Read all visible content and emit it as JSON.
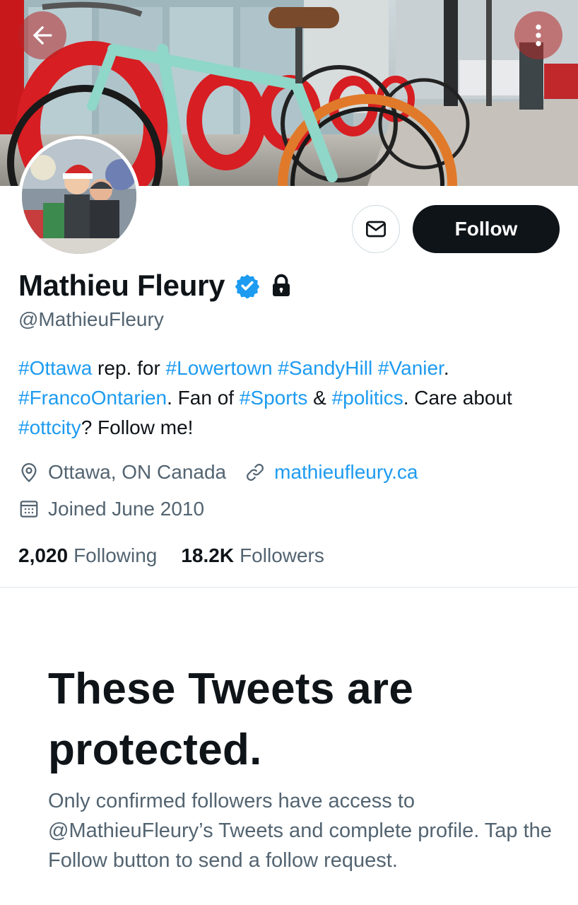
{
  "profile": {
    "display_name": "Mathieu Fleury",
    "handle": "@MathieuFleury",
    "verified_icon": "verified-badge-icon",
    "protected_icon": "lock-icon",
    "bio": [
      {
        "text": "#Ottawa",
        "tag": true
      },
      {
        "text": " rep. for ",
        "tag": false
      },
      {
        "text": "#Lowertown",
        "tag": true
      },
      {
        "text": " ",
        "tag": false
      },
      {
        "text": "#SandyHill",
        "tag": true
      },
      {
        "text": " ",
        "tag": false
      },
      {
        "text": "#Vanier",
        "tag": true
      },
      {
        "text": ". ",
        "tag": false
      },
      {
        "text": "#FrancoOntarien",
        "tag": true
      },
      {
        "text": ". Fan of ",
        "tag": false
      },
      {
        "text": "#Sports",
        "tag": true
      },
      {
        "text": " & ",
        "tag": false
      },
      {
        "text": "#politics",
        "tag": true
      },
      {
        "text": ". Care about ",
        "tag": false
      },
      {
        "text": "#ottcity",
        "tag": true
      },
      {
        "text": "? Follow me!",
        "tag": false
      }
    ],
    "location": "Ottawa, ON Canada",
    "website": "mathieufleury.ca",
    "joined": "Joined June 2010",
    "following_count": "2,020",
    "following_label": "Following",
    "followers_count": "18.2K",
    "followers_label": "Followers"
  },
  "actions": {
    "follow_label": "Follow",
    "message_icon": "envelope-icon",
    "back_icon": "back-arrow-icon",
    "more_icon": "more-vertical-icon"
  },
  "protected_notice": {
    "title": "These Tweets are protected.",
    "body": "Only confirmed followers have access to @MathieuFleury’s Tweets and complete profile. Tap the Follow button to send a follow request."
  },
  "colors": {
    "accent": "#1d9bf0",
    "text_primary": "#0f1419",
    "text_secondary": "#536471",
    "follow_button": "#0f1419"
  }
}
